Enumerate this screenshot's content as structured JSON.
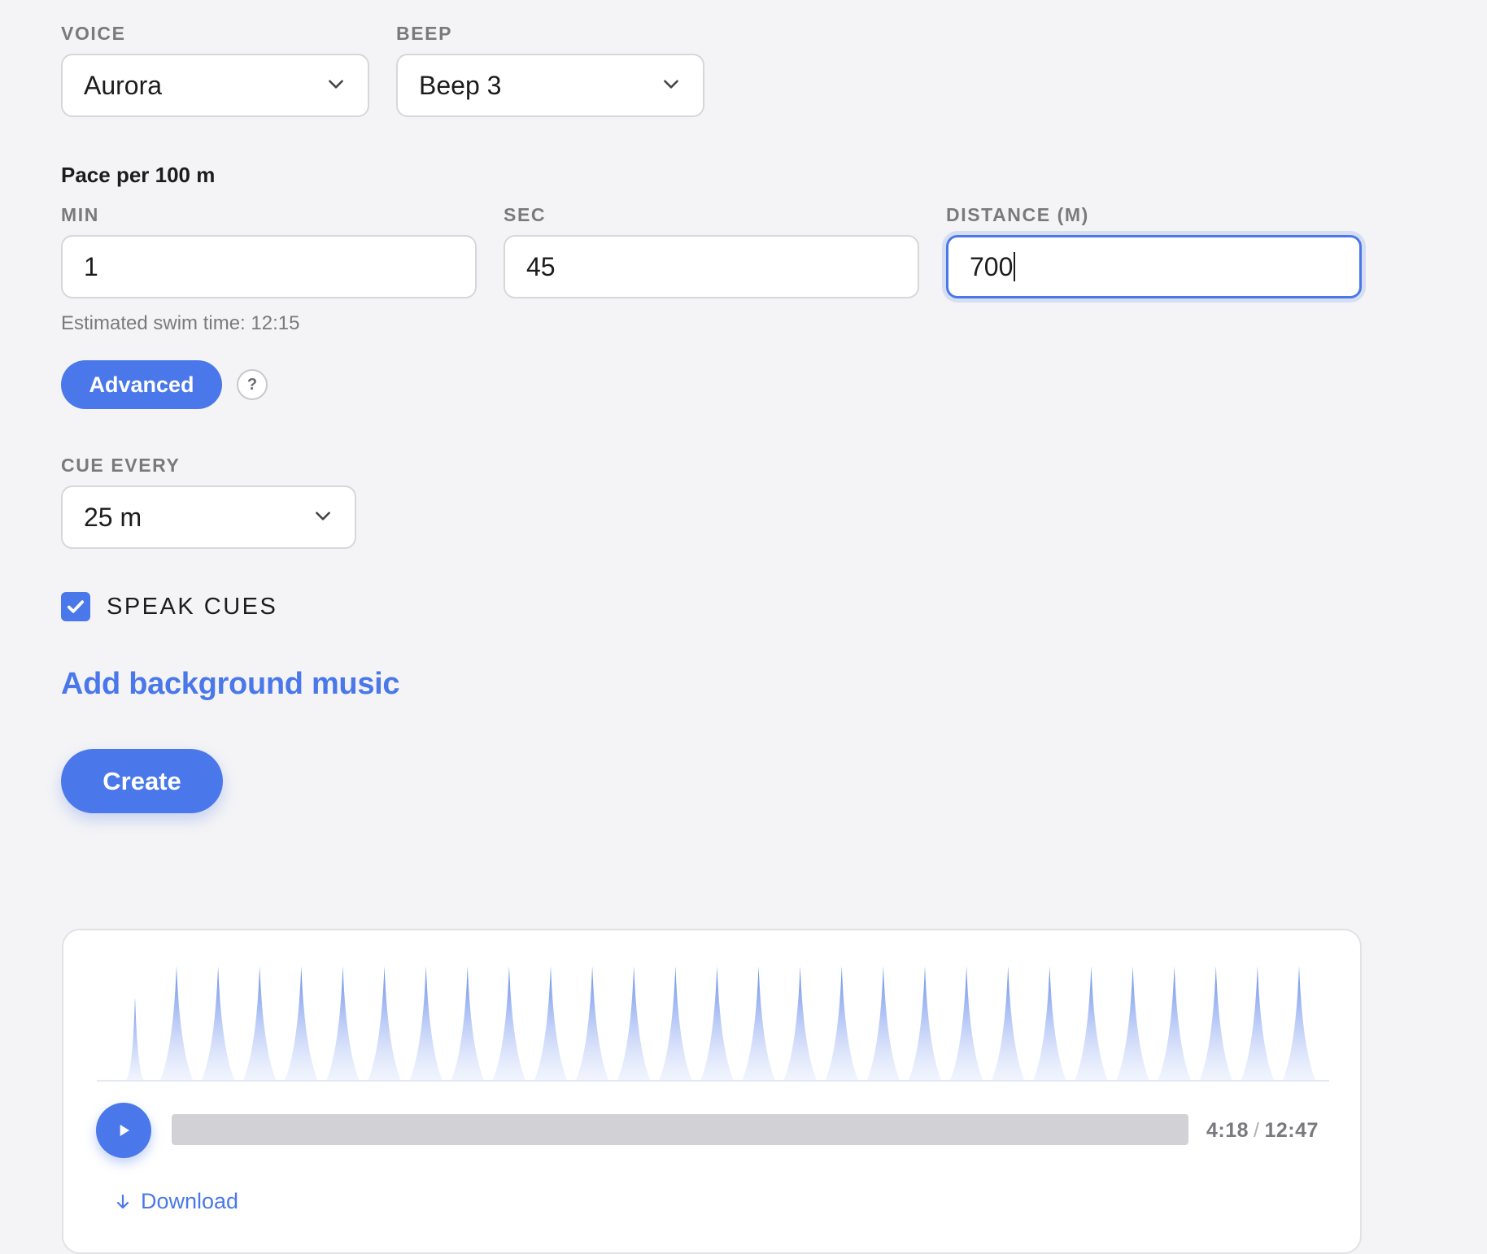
{
  "voice": {
    "label": "VOICE",
    "value": "Aurora"
  },
  "beep": {
    "label": "BEEP",
    "value": "Beep 3"
  },
  "pace": {
    "heading": "Pace per 100 m",
    "min": {
      "label": "MIN",
      "value": "1"
    },
    "sec": {
      "label": "SEC",
      "value": "45"
    },
    "distance": {
      "label": "DISTANCE (M)",
      "value": "700"
    },
    "estimate": "Estimated swim time: 12:15"
  },
  "advanced": {
    "label": "Advanced",
    "help": "?"
  },
  "cue_every": {
    "label": "CUE EVERY",
    "value": "25 m"
  },
  "speak_cues": {
    "label": "SPEAK CUES",
    "checked": true
  },
  "background_music": {
    "label": "Add background music"
  },
  "create": {
    "label": "Create"
  },
  "player": {
    "current_time": "4:18",
    "separator": "/",
    "total_time": "12:47",
    "download_label": "Download",
    "peak_count": 28
  },
  "colors": {
    "accent": "#4a78ea",
    "background": "#f4f4f6",
    "track": "#d1d1d6"
  },
  "icons": {
    "dropdown": "chevron-down-icon",
    "check": "check-icon",
    "play": "play-icon",
    "download": "arrow-down-icon"
  }
}
